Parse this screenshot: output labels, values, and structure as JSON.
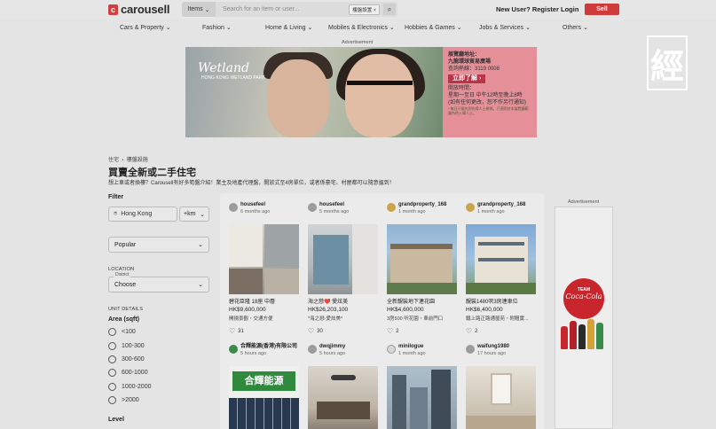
{
  "header": {
    "logo_text": "carousell",
    "search_category": "Items",
    "search_placeholder": "Search for an item or user...",
    "search_chip": "樓盤設置",
    "links": [
      "New User? Register",
      "Login"
    ],
    "sell_label": "Sell"
  },
  "categories": [
    "Cars & Property",
    "Fashion",
    "Home & Living",
    "Mobiles & Electronics",
    "Hobbies & Games",
    "Jobs & Services",
    "Others"
  ],
  "watermark": "經",
  "banner": {
    "label": "Advertisement",
    "brand": "Wetland",
    "brand_sub": "HONG KONG WETLAND PARK",
    "info_lines": [
      "展覽廳地址：",
      "九龍環球貿易廣場",
      "查詢熱線：3119 0008"
    ],
    "cta": "立即了解 ›",
    "hours_lines": [
      "開放時間：",
      "星期一至日 中午12時至晚上8時",
      "(如有任何更改，恕不作另行通知)"
    ],
    "fine_print": "* 每日只限先到先得人士參與。只適用於本展覽廳範圍內的入場人士。"
  },
  "breadcrumb": [
    "住宅",
    "樓盤設施"
  ],
  "page": {
    "title": "買賣全新或二手住宅",
    "desc": "想上車或者換樓？Carousell有好多筍盤介紹！業主及地產代理盤，開放式至4房單位，或者係豪宅、村屋都可以隨意揾到！"
  },
  "filter": {
    "title": "Filter",
    "location": "Hong Kong",
    "radius": "+km",
    "sort": "Popular",
    "location_section": "LOCATION",
    "district_label": "District",
    "district_value": "Choose",
    "unit_section": "UNIT DETAILS",
    "area_title": "Area (sqft)",
    "area_options": [
      "<100",
      "100-300",
      "300-600",
      "600-1000",
      "1000-2000",
      ">2000"
    ],
    "level_title": "Level"
  },
  "listings": [
    {
      "user": "housefeel",
      "time": "6 months ago",
      "title": "碧花臣隆 18座 中層",
      "price": "HK$9,600,000",
      "desc": "開揚景觀・交通方便",
      "likes": "31"
    },
    {
      "user": "housefeel",
      "time": "5 months ago",
      "title": "海之戀❤️ 愛炫美",
      "price": "HK$26,203,100",
      "desc": "*海之戀·愛炫美*",
      "likes": "30"
    },
    {
      "user": "grandproperty_168",
      "time": "1 month ago",
      "title": "全新靚裝地下連花園",
      "price": "HK$4,600,000",
      "desc": "3房500 呎花園・車前門口",
      "likes": "2"
    },
    {
      "user": "grandproperty_168",
      "time": "1 month ago",
      "title": "靚裝1480呎3房連車位",
      "price": "HK$6,400,000",
      "desc": "鐵上路正路通屋苑・附贈實...",
      "likes": "2"
    },
    {
      "user": "合輝能源(香港)有限公司",
      "time": "5 hours ago",
      "img_text": "合輝能源"
    },
    {
      "user": "dwqjimmy",
      "time": "5 hours ago"
    },
    {
      "user": "minilogue",
      "time": "1 month ago"
    },
    {
      "user": "waifung1980",
      "time": "17 hours ago"
    }
  ],
  "right_ad": {
    "label": "Advertisement",
    "team": "TEAM",
    "brand": "Coca-Cola"
  }
}
